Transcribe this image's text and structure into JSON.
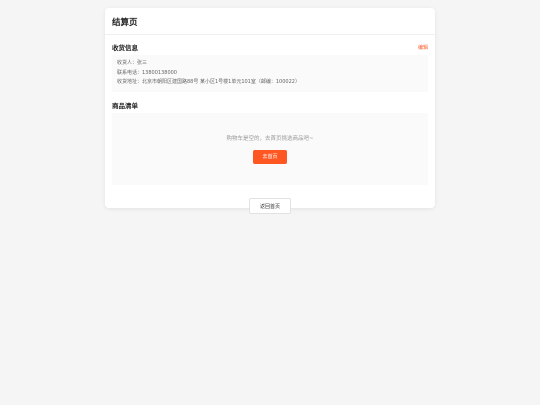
{
  "page": {
    "title": "结算页"
  },
  "address": {
    "section_title": "收货信息",
    "edit_label": "编辑",
    "receiver": "收货人：张三",
    "phone": "联系电话：13800138000",
    "full_address": "收货地址：北京市朝阳区建国路88号 某小区1号楼1单元101室（邮编：100022）"
  },
  "goods": {
    "section_title": "商品清单",
    "empty_text": "购物车是空的，去首页挑选商品吧~",
    "go_home_label": "去首页"
  },
  "footer": {
    "back_home_label": "返回首页"
  },
  "colors": {
    "accent": "#ff5722",
    "background": "#f5f5f5",
    "card": "#ffffff"
  }
}
